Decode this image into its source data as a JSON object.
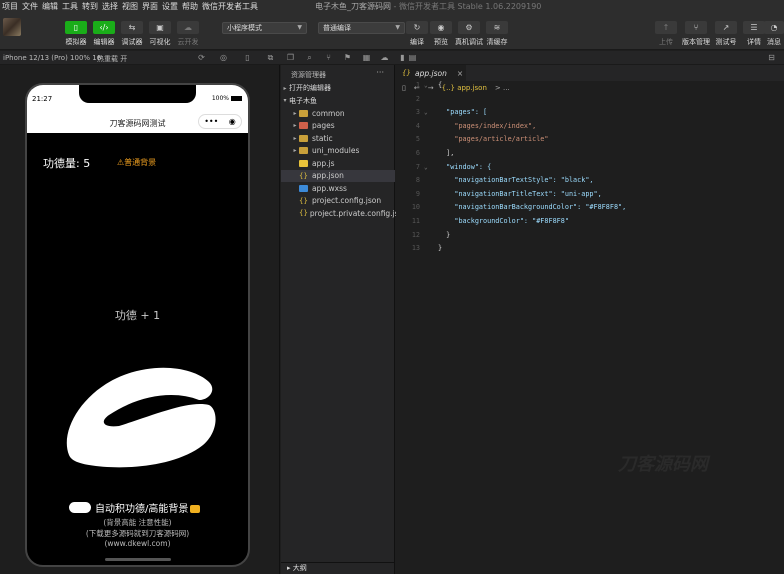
{
  "menu": {
    "items": [
      "项目",
      "文件",
      "编辑",
      "工具",
      "转到",
      "选择",
      "视图",
      "界面",
      "设置",
      "帮助",
      "微信开发者工具"
    ],
    "title": "电子木鱼_刀客源码网",
    "subtitle": " - 微信开发者工具 Stable 1.06.2209190"
  },
  "toolbar": {
    "simulator": "模拟器",
    "editor": "编辑器",
    "debugger": "调试器",
    "visual": "可视化",
    "cloud": "云开发",
    "mode_select": "小程序模式",
    "compile_select": "普通编译",
    "compile": "编译",
    "preview": "预览",
    "real_debug": "真机调试",
    "clear_cache": "清缓存",
    "upload": "上传",
    "version": "版本管理",
    "test": "测试号",
    "details": "详情",
    "messages": "消息"
  },
  "device": {
    "model": "iPhone 12/13 (Pro) 100% 16",
    "hotreload": "热重载 开"
  },
  "phone": {
    "time": "21:27",
    "battery": "100%",
    "nav_title": "刀客源码网测试",
    "capsule_more": "•••",
    "capsule_close": "◉",
    "merit_label": "功德量: 5",
    "bg_button": "⚠普通背景",
    "plus_text": "功德 + 1",
    "auto_text": "自动积功德/高能背景",
    "sub1": "(背景高能 注意性能)",
    "sub2": "(下载更多源码就到刀客源码网)",
    "sub3": "(www.dkewl.com)"
  },
  "explorer": {
    "header": "资源管理器",
    "more": "···",
    "open_editors": "打开的编辑器",
    "project": "电子木鱼",
    "items": [
      {
        "name": "common",
        "type": "folder"
      },
      {
        "name": "pages",
        "type": "folder-red"
      },
      {
        "name": "static",
        "type": "folder"
      },
      {
        "name": "uni_modules",
        "type": "folder"
      },
      {
        "name": "app.js",
        "type": "js"
      },
      {
        "name": "app.json",
        "type": "json"
      },
      {
        "name": "app.wxss",
        "type": "wxss"
      },
      {
        "name": "project.config.json",
        "type": "json"
      },
      {
        "name": "project.private.config.js...",
        "type": "json"
      }
    ],
    "outline": "大纲"
  },
  "editor": {
    "tab": "app.json",
    "tab_close": "×",
    "breadcrumb": [
      "{..} app.json",
      "> ..."
    ],
    "lines": [
      {
        "n": "1",
        "t": "{"
      },
      {
        "n": "2",
        "t": ""
      },
      {
        "n": "3",
        "t": "  \"pages\": ["
      },
      {
        "n": "4",
        "t": "    \"pages/index/index\","
      },
      {
        "n": "5",
        "t": "    \"pages/article/article\""
      },
      {
        "n": "6",
        "t": "  ],"
      },
      {
        "n": "7",
        "t": "  \"window\": {"
      },
      {
        "n": "8",
        "t": "    \"navigationBarTextStyle\": \"black\","
      },
      {
        "n": "9",
        "t": "    \"navigationBarTitleText\": \"uni-app\","
      },
      {
        "n": "10",
        "t": "    \"navigationBarBackgroundColor\": \"#F8F8F8\","
      },
      {
        "n": "11",
        "t": "    \"backgroundColor\": \"#F8F8F8\""
      },
      {
        "n": "12",
        "t": "  }"
      },
      {
        "n": "13",
        "t": "}"
      }
    ],
    "watermark": "刀客源码网"
  },
  "colors": {
    "accent_green": "#1aad19",
    "bg_dark": "#1e1e1e",
    "badge_orange": "#f0a020"
  }
}
